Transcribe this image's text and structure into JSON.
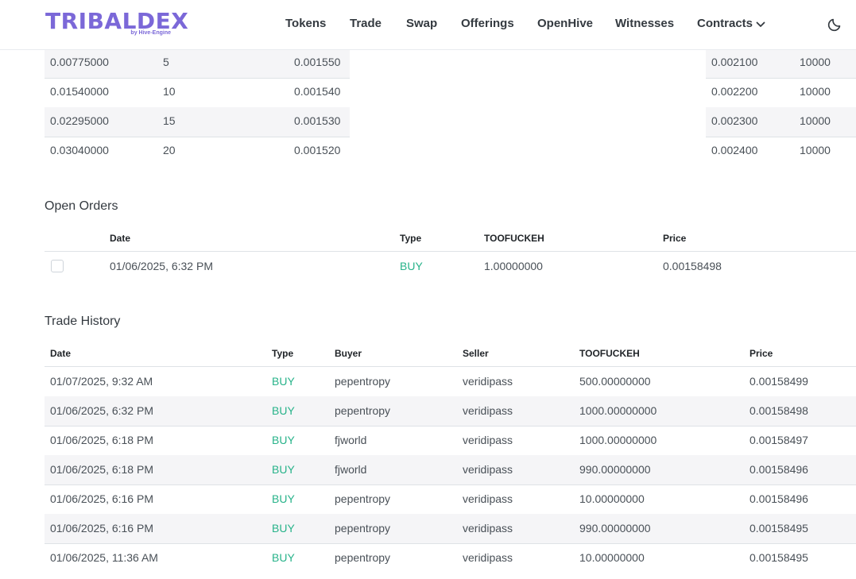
{
  "header": {
    "logo_text": "TRIBALDEX",
    "logo_sub": "by Hive-Engine",
    "nav": [
      "Tokens",
      "Trade",
      "Swap",
      "Offerings",
      "OpenHive",
      "Witnesses",
      "Contracts"
    ],
    "theme_icon": "moon-icon"
  },
  "buy_book": {
    "rows": [
      [
        "0.00775000",
        "5",
        "0.001550"
      ],
      [
        "0.01540000",
        "10",
        "0.001540"
      ],
      [
        "0.02295000",
        "15",
        "0.001530"
      ],
      [
        "0.03040000",
        "20",
        "0.001520"
      ]
    ]
  },
  "sell_book": {
    "rows": [
      [
        "0.002100",
        "10000"
      ],
      [
        "0.002200",
        "10000"
      ],
      [
        "0.002300",
        "10000"
      ],
      [
        "0.002400",
        "10000"
      ]
    ]
  },
  "open_orders": {
    "title": "Open Orders",
    "headers": [
      "Date",
      "Type",
      "TOOFUCKEH",
      "Price"
    ],
    "rows": [
      [
        "01/06/2025, 6:32 PM",
        "BUY",
        "1.00000000",
        "0.00158498"
      ]
    ]
  },
  "trade_history": {
    "title": "Trade History",
    "headers": [
      "Date",
      "Type",
      "Buyer",
      "Seller",
      "TOOFUCKEH",
      "Price"
    ],
    "rows": [
      [
        "01/07/2025, 9:32 AM",
        "BUY",
        "pepentropy",
        "veridipass",
        "500.00000000",
        "0.00158499"
      ],
      [
        "01/06/2025, 6:32 PM",
        "BUY",
        "pepentropy",
        "veridipass",
        "1000.00000000",
        "0.00158498"
      ],
      [
        "01/06/2025, 6:18 PM",
        "BUY",
        "fjworld",
        "veridipass",
        "1000.00000000",
        "0.00158497"
      ],
      [
        "01/06/2025, 6:18 PM",
        "BUY",
        "fjworld",
        "veridipass",
        "990.00000000",
        "0.00158496"
      ],
      [
        "01/06/2025, 6:16 PM",
        "BUY",
        "pepentropy",
        "veridipass",
        "10.00000000",
        "0.00158496"
      ],
      [
        "01/06/2025, 6:16 PM",
        "BUY",
        "pepentropy",
        "veridipass",
        "990.00000000",
        "0.00158495"
      ],
      [
        "01/06/2025, 11:36 AM",
        "BUY",
        "pepentropy",
        "veridipass",
        "10.00000000",
        "0.00158495"
      ]
    ]
  },
  "colors": {
    "brand": "#7b68d8",
    "buy": "#28b38a",
    "row_shade": "#f5f5f7"
  }
}
